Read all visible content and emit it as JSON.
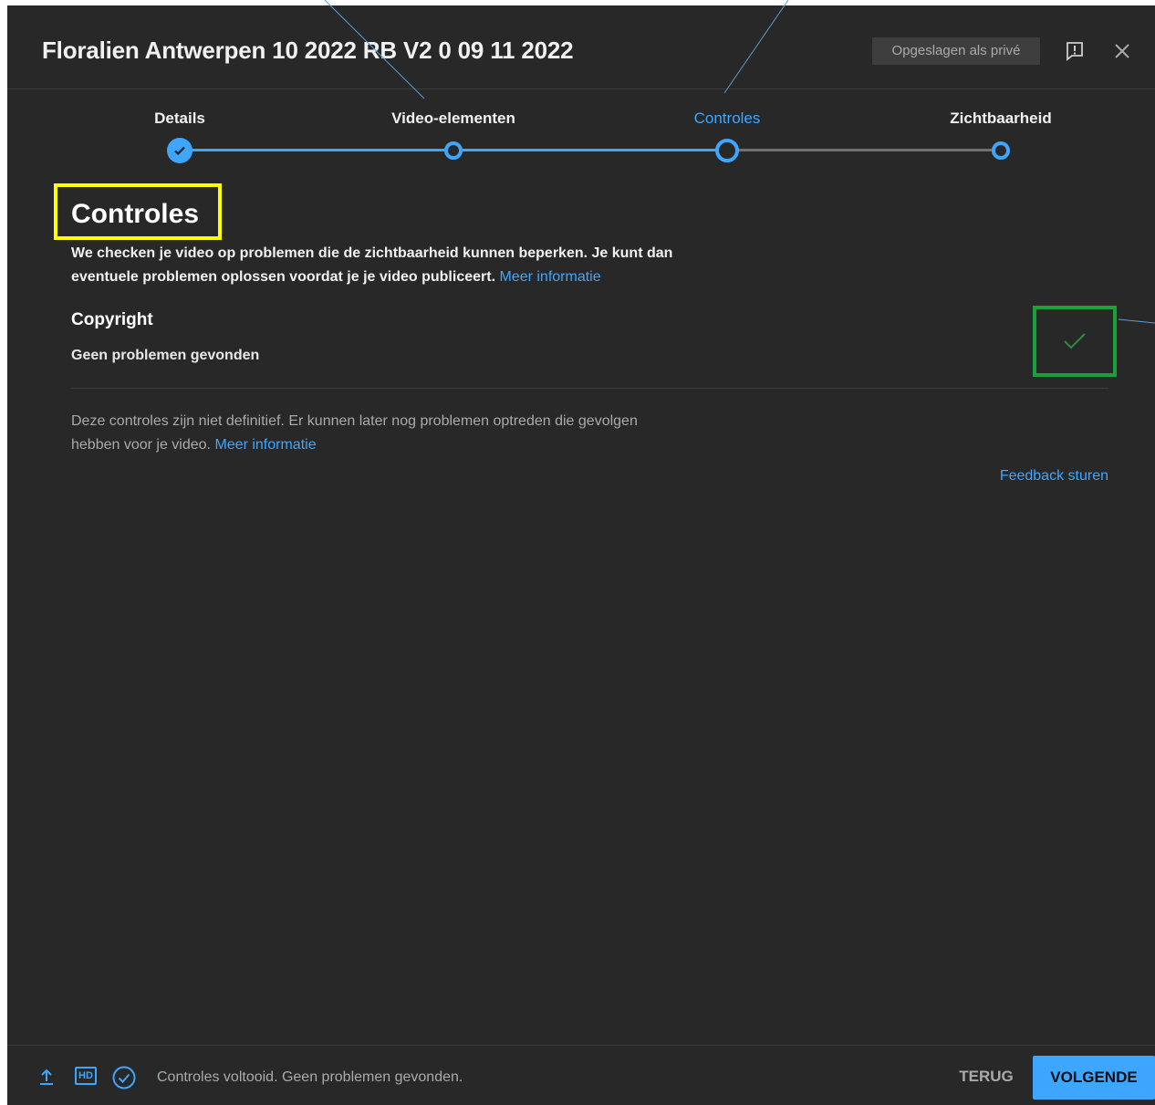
{
  "dialog": {
    "title": "Floralien Antwerpen 10 2022 RB V2 0 09 11 2022",
    "saved_chip": "Opgeslagen als privé"
  },
  "steps": [
    {
      "label": "Details",
      "state": "done"
    },
    {
      "label": "Video-elementen",
      "state": "done"
    },
    {
      "label": "Controles",
      "state": "active"
    },
    {
      "label": "Zichtbaarheid",
      "state": "pending"
    }
  ],
  "content": {
    "section_title": "Controles",
    "intro_text": "We checken je video op problemen die de zichtbaarheid kunnen beperken. Je kunt dan eventuele problemen oplossen voordat je je video publiceert.",
    "intro_link": "Meer informatie",
    "copyright_label": "Copyright",
    "copyright_status": "Geen problemen gevonden",
    "disclaimer_text": "Deze controles zijn niet definitief. Er kunnen later nog problemen optreden die gevolgen hebben voor je video.",
    "disclaimer_link": "Meer informatie",
    "send_feedback": "Feedback sturen"
  },
  "footer": {
    "hd_label": "HD",
    "status_text": "Controles voltooid. Geen problemen gevonden.",
    "back_label": "TERUG",
    "next_label": "VOLGENDE"
  },
  "icons": {
    "feedback": "report-flag-icon",
    "close": "close-icon",
    "upload": "upload-icon",
    "checks": "check-circle-icon",
    "copyright_ok": "checkmark-icon"
  },
  "colors": {
    "background": "#282828",
    "accent": "#3ea6ff",
    "success": "#19a13a",
    "highlight": "#ffff00"
  }
}
